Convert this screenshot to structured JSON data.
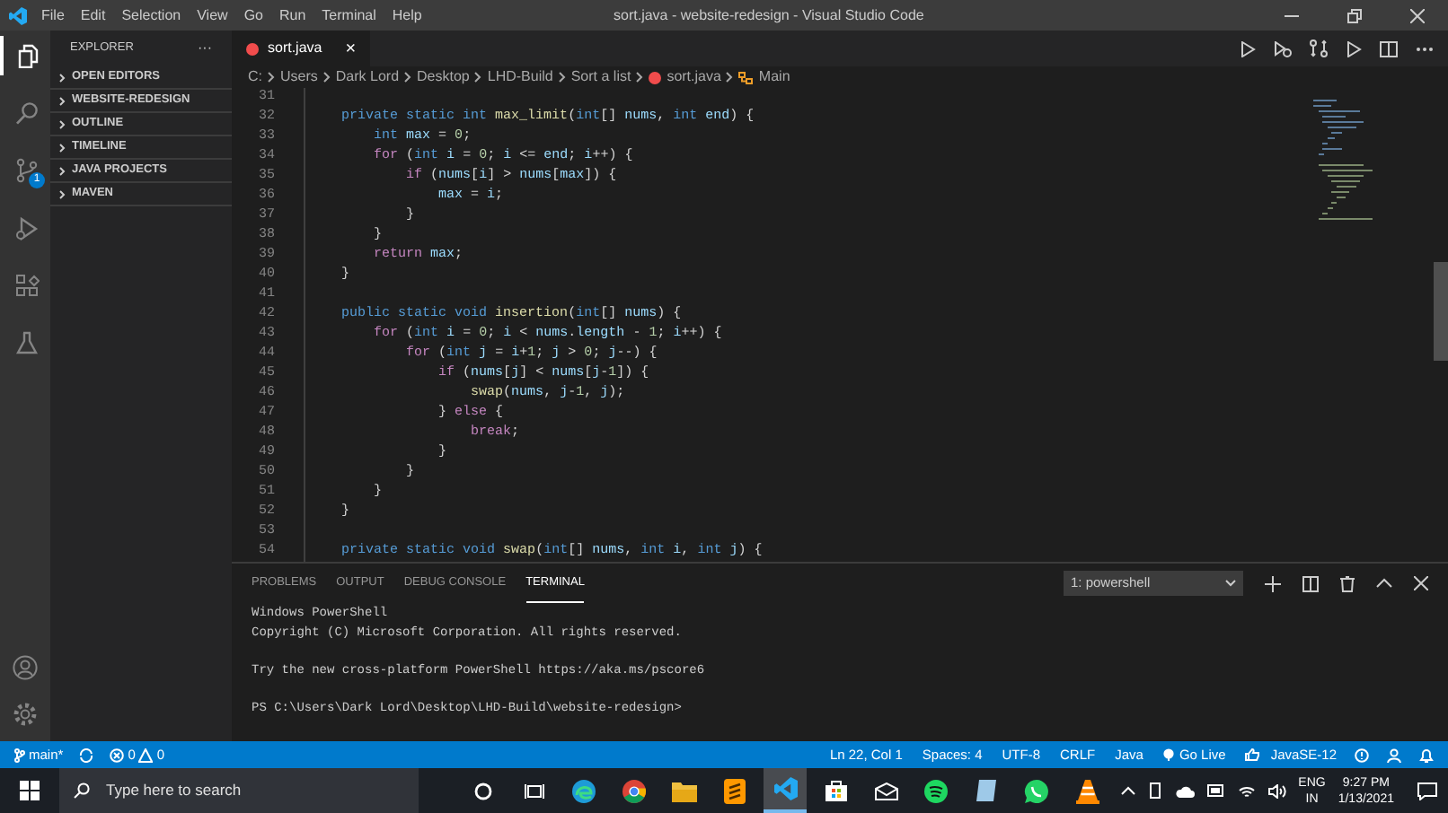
{
  "window": {
    "title": "sort.java - website-redesign - Visual Studio Code"
  },
  "menu": [
    "File",
    "Edit",
    "Selection",
    "View",
    "Go",
    "Run",
    "Terminal",
    "Help"
  ],
  "activity_bar": [
    {
      "kind": "files",
      "selected": true
    },
    {
      "kind": "search",
      "selected": false
    },
    {
      "kind": "source-control",
      "selected": false,
      "badge": "1"
    },
    {
      "kind": "run",
      "selected": false
    },
    {
      "kind": "extensions",
      "selected": false
    },
    {
      "kind": "test",
      "selected": false
    }
  ],
  "sidebar": {
    "title": "EXPLORER",
    "more": "···",
    "sections": [
      {
        "label": "OPEN EDITORS",
        "expanded": false
      },
      {
        "label": "WEBSITE-REDESIGN",
        "expanded": false
      },
      {
        "label": "OUTLINE",
        "expanded": false
      },
      {
        "label": "TIMELINE",
        "expanded": false
      },
      {
        "label": "JAVA PROJECTS",
        "expanded": false
      },
      {
        "label": "MAVEN",
        "expanded": false
      }
    ]
  },
  "tabs": [
    {
      "label": "sort.java",
      "selected": true,
      "close": "×"
    }
  ],
  "breadcrumb": [
    "C:",
    "Users",
    "Dark Lord",
    "Desktop",
    "LHD-Build",
    "Sort a list",
    "sort.java",
    "Main"
  ],
  "code": [
    {
      "number": "31"
    },
    {
      "number": "32",
      "tokens": [
        {
          "kind": "keyword",
          "text": "    private"
        },
        {
          "kind": "keyword",
          "text": " static"
        },
        {
          "kind": "keyword",
          "text": " int"
        },
        {
          "kind": "function",
          "text": " max_limit"
        },
        {
          "kind": "plain",
          "text": "("
        },
        {
          "kind": "keyword",
          "text": "int"
        },
        {
          "kind": "plain",
          "text": "[]"
        },
        {
          "kind": "variable",
          "text": " nums"
        },
        {
          "kind": "plain",
          "text": ","
        },
        {
          "kind": "keyword",
          "text": " int"
        },
        {
          "kind": "variable",
          "text": " end"
        },
        {
          "kind": "plain",
          "text": ") {"
        }
      ]
    },
    {
      "number": "33",
      "tokens": [
        {
          "kind": "keyword",
          "text": "        int"
        },
        {
          "kind": "variable",
          "text": " max"
        },
        {
          "kind": "plain",
          "text": " ="
        },
        {
          "kind": "number",
          "text": " 0"
        },
        {
          "kind": "plain",
          "text": ";"
        }
      ]
    },
    {
      "number": "34",
      "tokens": [
        {
          "kind": "control",
          "text": "        for"
        },
        {
          "kind": "plain",
          "text": " ("
        },
        {
          "kind": "keyword",
          "text": "int"
        },
        {
          "kind": "variable",
          "text": " i"
        },
        {
          "kind": "plain",
          "text": " ="
        },
        {
          "kind": "number",
          "text": " 0"
        },
        {
          "kind": "plain",
          "text": ";"
        },
        {
          "kind": "variable",
          "text": " i"
        },
        {
          "kind": "plain",
          "text": " <="
        },
        {
          "kind": "variable",
          "text": " end"
        },
        {
          "kind": "plain",
          "text": ";"
        },
        {
          "kind": "variable",
          "text": " i"
        },
        {
          "kind": "plain",
          "text": "++) {"
        }
      ]
    },
    {
      "number": "35",
      "tokens": [
        {
          "kind": "control",
          "text": "            if"
        },
        {
          "kind": "plain",
          "text": " ("
        },
        {
          "kind": "variable",
          "text": "nums"
        },
        {
          "kind": "plain",
          "text": "["
        },
        {
          "kind": "variable",
          "text": "i"
        },
        {
          "kind": "plain",
          "text": "] >"
        },
        {
          "kind": "variable",
          "text": " nums"
        },
        {
          "kind": "plain",
          "text": "["
        },
        {
          "kind": "variable",
          "text": "max"
        },
        {
          "kind": "plain",
          "text": "]) {"
        }
      ]
    },
    {
      "number": "36",
      "tokens": [
        {
          "kind": "variable",
          "text": "                max"
        },
        {
          "kind": "plain",
          "text": " ="
        },
        {
          "kind": "variable",
          "text": " i"
        },
        {
          "kind": "plain",
          "text": ";"
        }
      ]
    },
    {
      "number": "37",
      "tokens": [
        {
          "kind": "plain",
          "text": "            }"
        }
      ]
    },
    {
      "number": "38",
      "tokens": [
        {
          "kind": "plain",
          "text": "        }"
        }
      ]
    },
    {
      "number": "39",
      "tokens": [
        {
          "kind": "control",
          "text": "        return"
        },
        {
          "kind": "variable",
          "text": " max"
        },
        {
          "kind": "plain",
          "text": ";"
        }
      ]
    },
    {
      "number": "40",
      "tokens": [
        {
          "kind": "plain",
          "text": "    }"
        }
      ]
    },
    {
      "number": "41"
    },
    {
      "number": "42",
      "tokens": [
        {
          "kind": "keyword",
          "text": "    public"
        },
        {
          "kind": "keyword",
          "text": " static"
        },
        {
          "kind": "keyword",
          "text": " void"
        },
        {
          "kind": "function",
          "text": " insertion"
        },
        {
          "kind": "plain",
          "text": "("
        },
        {
          "kind": "keyword",
          "text": "int"
        },
        {
          "kind": "plain",
          "text": "[]"
        },
        {
          "kind": "variable",
          "text": " nums"
        },
        {
          "kind": "plain",
          "text": ") {"
        }
      ]
    },
    {
      "number": "43",
      "tokens": [
        {
          "kind": "control",
          "text": "        for"
        },
        {
          "kind": "plain",
          "text": " ("
        },
        {
          "kind": "keyword",
          "text": "int"
        },
        {
          "kind": "variable",
          "text": " i"
        },
        {
          "kind": "plain",
          "text": " ="
        },
        {
          "kind": "number",
          "text": " 0"
        },
        {
          "kind": "plain",
          "text": ";"
        },
        {
          "kind": "variable",
          "text": " i"
        },
        {
          "kind": "plain",
          "text": " <"
        },
        {
          "kind": "variable",
          "text": " nums"
        },
        {
          "kind": "plain",
          "text": "."
        },
        {
          "kind": "variable",
          "text": "length"
        },
        {
          "kind": "plain",
          "text": " -"
        },
        {
          "kind": "number",
          "text": " 1"
        },
        {
          "kind": "plain",
          "text": ";"
        },
        {
          "kind": "variable",
          "text": " i"
        },
        {
          "kind": "plain",
          "text": "++) {"
        }
      ]
    },
    {
      "number": "44",
      "tokens": [
        {
          "kind": "control",
          "text": "            for"
        },
        {
          "kind": "plain",
          "text": " ("
        },
        {
          "kind": "keyword",
          "text": "int"
        },
        {
          "kind": "variable",
          "text": " j"
        },
        {
          "kind": "plain",
          "text": " ="
        },
        {
          "kind": "variable",
          "text": " i"
        },
        {
          "kind": "plain",
          "text": "+"
        },
        {
          "kind": "number",
          "text": "1"
        },
        {
          "kind": "plain",
          "text": ";"
        },
        {
          "kind": "variable",
          "text": " j"
        },
        {
          "kind": "plain",
          "text": " >"
        },
        {
          "kind": "number",
          "text": " 0"
        },
        {
          "kind": "plain",
          "text": ";"
        },
        {
          "kind": "variable",
          "text": " j"
        },
        {
          "kind": "plain",
          "text": "--) {"
        }
      ]
    },
    {
      "number": "45",
      "tokens": [
        {
          "kind": "control",
          "text": "                if"
        },
        {
          "kind": "plain",
          "text": " ("
        },
        {
          "kind": "variable",
          "text": "nums"
        },
        {
          "kind": "plain",
          "text": "["
        },
        {
          "kind": "variable",
          "text": "j"
        },
        {
          "kind": "plain",
          "text": "] <"
        },
        {
          "kind": "variable",
          "text": " nums"
        },
        {
          "kind": "plain",
          "text": "["
        },
        {
          "kind": "variable",
          "text": "j"
        },
        {
          "kind": "plain",
          "text": "-"
        },
        {
          "kind": "number",
          "text": "1"
        },
        {
          "kind": "plain",
          "text": "]) {"
        }
      ]
    },
    {
      "number": "46",
      "tokens": [
        {
          "kind": "function",
          "text": "                    swap"
        },
        {
          "kind": "plain",
          "text": "("
        },
        {
          "kind": "variable",
          "text": "nums"
        },
        {
          "kind": "plain",
          "text": ","
        },
        {
          "kind": "variable",
          "text": " j"
        },
        {
          "kind": "plain",
          "text": "-"
        },
        {
          "kind": "number",
          "text": "1"
        },
        {
          "kind": "plain",
          "text": ","
        },
        {
          "kind": "variable",
          "text": " j"
        },
        {
          "kind": "plain",
          "text": ");"
        }
      ]
    },
    {
      "number": "47",
      "tokens": [
        {
          "kind": "plain",
          "text": "                }"
        },
        {
          "kind": "control",
          "text": " else"
        },
        {
          "kind": "plain",
          "text": " {"
        }
      ]
    },
    {
      "number": "48",
      "tokens": [
        {
          "kind": "control",
          "text": "                    break"
        },
        {
          "kind": "plain",
          "text": ";"
        }
      ]
    },
    {
      "number": "49",
      "tokens": [
        {
          "kind": "plain",
          "text": "                }"
        }
      ]
    },
    {
      "number": "50",
      "tokens": [
        {
          "kind": "plain",
          "text": "            }"
        }
      ]
    },
    {
      "number": "51",
      "tokens": [
        {
          "kind": "plain",
          "text": "        }"
        }
      ]
    },
    {
      "number": "52",
      "tokens": [
        {
          "kind": "plain",
          "text": "    }"
        }
      ]
    },
    {
      "number": "53"
    },
    {
      "number": "54",
      "tokens": [
        {
          "kind": "keyword",
          "text": "    private"
        },
        {
          "kind": "keyword",
          "text": " static"
        },
        {
          "kind": "keyword",
          "text": " void"
        },
        {
          "kind": "function",
          "text": " swap"
        },
        {
          "kind": "plain",
          "text": "("
        },
        {
          "kind": "keyword",
          "text": "int"
        },
        {
          "kind": "plain",
          "text": "[]"
        },
        {
          "kind": "variable",
          "text": " nums"
        },
        {
          "kind": "plain",
          "text": ","
        },
        {
          "kind": "keyword",
          "text": " int"
        },
        {
          "kind": "variable",
          "text": " i"
        },
        {
          "kind": "plain",
          "text": ","
        },
        {
          "kind": "keyword",
          "text": " int"
        },
        {
          "kind": "variable",
          "text": " j"
        },
        {
          "kind": "plain",
          "text": ") {"
        }
      ]
    }
  ],
  "panel": {
    "tabs": [
      {
        "label": "PROBLEMS",
        "selected": false
      },
      {
        "label": "OUTPUT",
        "selected": false
      },
      {
        "label": "DEBUG CONSOLE",
        "selected": false
      },
      {
        "label": "TERMINAL",
        "selected": true
      }
    ],
    "terminal_select": "1: powershell",
    "terminal_blocks": [
      [
        "Windows PowerShell",
        "Copyright (C) Microsoft Corporation. All rights reserved."
      ],
      [
        "Try the new cross-platform PowerShell https://aka.ms/pscore6"
      ],
      [
        "PS C:\\Users\\Dark Lord\\Desktop\\LHD-Build\\website-redesign>"
      ]
    ]
  },
  "status_bar": {
    "branch": "main*",
    "errors": "0",
    "warnings": "0",
    "right": [
      {
        "kind": "text",
        "text": "Ln 22, Col 1"
      },
      {
        "kind": "text",
        "text": "Spaces: 4"
      },
      {
        "kind": "text",
        "text": "UTF-8"
      },
      {
        "kind": "text",
        "text": "CRLF"
      },
      {
        "kind": "text",
        "text": "Java"
      },
      {
        "kind": "golive",
        "text": "Go Live"
      },
      {
        "kind": "java",
        "text": "JavaSE-12"
      }
    ]
  },
  "taskbar": {
    "search_placeholder": "Type here to search",
    "language": "ENG",
    "region": "IN",
    "time": "9:27 PM",
    "date": "1/13/2021"
  }
}
